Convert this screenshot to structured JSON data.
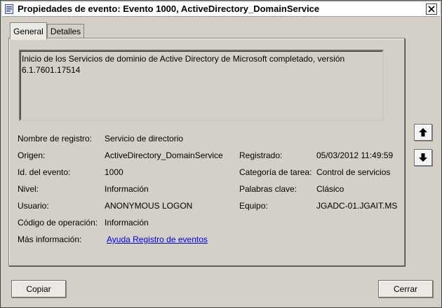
{
  "window": {
    "title": "Propiedades de evento: Evento 1000, ActiveDirectory_DomainService"
  },
  "tabs": [
    {
      "label": "General",
      "active": true
    },
    {
      "label": "Detalles",
      "active": false
    }
  ],
  "event": {
    "description": "Inicio de los Servicios de dominio de Active Directory de Microsoft completado, versión\n6.1.7601.17514",
    "fields": {
      "log_name": {
        "label": "Nombre de registro:",
        "value": "Servicio de directorio"
      },
      "source": {
        "label": "Origen:",
        "value": "ActiveDirectory_DomainService"
      },
      "logged": {
        "label": "Registrado:",
        "value": "05/03/2012 11:49:59"
      },
      "event_id": {
        "label": "Id. del evento:",
        "value": "1000"
      },
      "task_category": {
        "label": "Categoría de tarea:",
        "value": "Control de servicios"
      },
      "level": {
        "label": "Nivel:",
        "value": "Información"
      },
      "keywords": {
        "label": "Palabras clave:",
        "value": "Clásico"
      },
      "user": {
        "label": "Usuario:",
        "value": "ANONYMOUS LOGON"
      },
      "computer": {
        "label": "Equipo:",
        "value": "JGADC-01.JGAIT.MS"
      },
      "opcode": {
        "label": "Código de operación:",
        "value": "Información"
      },
      "more_info": {
        "label": "Más información:",
        "value": "Ayuda Registro de eventos"
      }
    }
  },
  "side_buttons": {
    "up_icon": "arrow-up-icon",
    "down_icon": "arrow-down-icon"
  },
  "buttons": {
    "copy": "Copiar",
    "close": "Cerrar"
  }
}
